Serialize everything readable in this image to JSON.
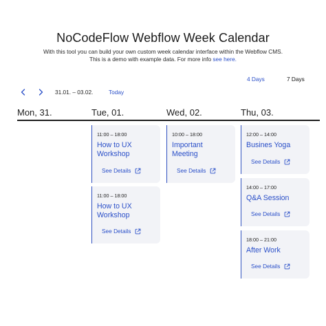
{
  "header": {
    "title": "NoCodeFlow Webflow Week Calendar",
    "subtitle_line1": "With this tool you can build your own custom week calendar interface within the Webflow CMS.",
    "subtitle_line2": "This is a demo with example data. For more info ",
    "subtitle_link": "see here."
  },
  "toolbar": {
    "range": "31.01. – 03.02.",
    "today_label": "Today",
    "view_4": "4 Days",
    "view_7": "7 Days"
  },
  "days": [
    {
      "label": "Mon, 31."
    },
    {
      "label": "Tue, 01."
    },
    {
      "label": "Wed, 02."
    },
    {
      "label": "Thu, 03."
    }
  ],
  "events": {
    "tue": [
      {
        "time": "11:00 – 18:00",
        "title_line1": "How to UX",
        "title_line2": "Workshop",
        "details": "See Details"
      },
      {
        "time": "11:00 – 18:00",
        "title_line1": "How to UX",
        "title_line2": "Workshop",
        "details": "See Details"
      }
    ],
    "wed": [
      {
        "time": "10:00 – 18:00",
        "title_line1": "Important",
        "title_line2": "Meeting",
        "details": "See Details"
      }
    ],
    "thu": [
      {
        "time": "12:00 – 14:00",
        "title_line1": "Busines Yoga",
        "details": "See Details"
      },
      {
        "time": "14:00 – 17:00",
        "title_line1": "Q&A Session",
        "details": "See Details"
      },
      {
        "time": "18:00 – 21:00",
        "title_line1": "After Work",
        "details": "See Details"
      }
    ]
  },
  "icons": {
    "prev": "chevron-left-icon",
    "next": "chevron-right-icon",
    "details": "external-link-icon"
  },
  "colors": {
    "accent": "#2a4fc8",
    "event_bg": "#f2f3f7",
    "text": "#1b1b1b"
  }
}
